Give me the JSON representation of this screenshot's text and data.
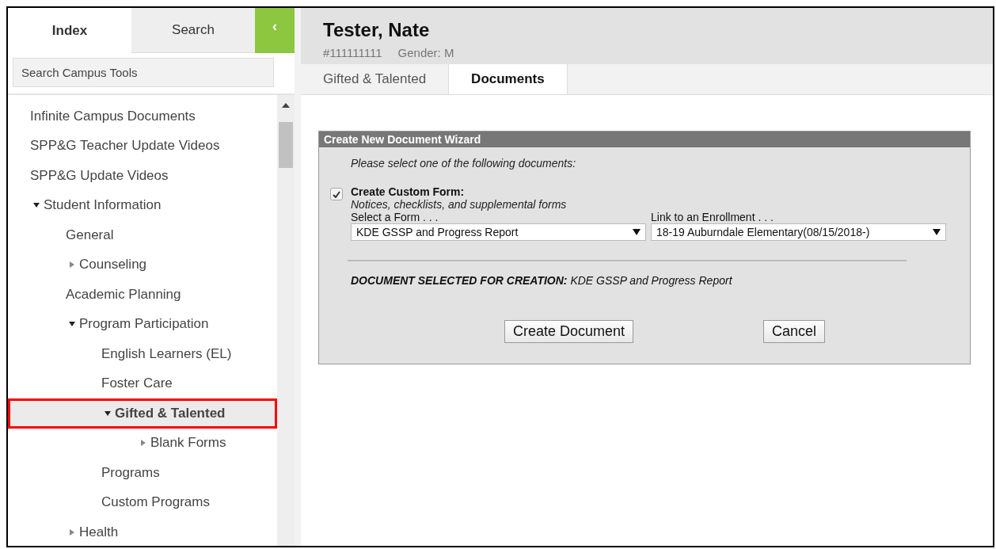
{
  "sidebar": {
    "tabs": [
      {
        "label": "Index",
        "selected": true
      },
      {
        "label": "Search",
        "selected": false
      }
    ],
    "collapse_button": {
      "label": "‹"
    },
    "search": {
      "placeholder": "Search Campus Tools"
    },
    "tree": [
      {
        "label": "Infinite Campus Documents",
        "kind": "leaf",
        "selected": false
      },
      {
        "label": "SPP&G Teacher Update Videos",
        "kind": "leaf",
        "selected": false
      },
      {
        "label": "SPP&G Update Videos",
        "kind": "leaf",
        "selected": false
      },
      {
        "label": "Student Information",
        "kind": "folder",
        "expanded": true,
        "selected": false,
        "children": [
          {
            "label": "General",
            "kind": "leaf",
            "selected": false
          },
          {
            "label": "Counseling",
            "kind": "folder",
            "expanded": false,
            "selected": false
          },
          {
            "label": "Academic Planning",
            "kind": "leaf",
            "selected": false
          },
          {
            "label": "Program Participation",
            "kind": "folder",
            "expanded": true,
            "selected": false,
            "children": [
              {
                "label": "English Learners (EL)",
                "kind": "leaf",
                "selected": false
              },
              {
                "label": "Foster Care",
                "kind": "leaf",
                "selected": false
              },
              {
                "label": "Gifted & Talented",
                "kind": "folder",
                "expanded": true,
                "selected": true,
                "children": [
                  {
                    "label": "Blank Forms",
                    "kind": "folder",
                    "expanded": false,
                    "selected": false
                  }
                ]
              },
              {
                "label": "Programs",
                "kind": "leaf",
                "selected": false
              },
              {
                "label": "Custom Programs",
                "kind": "leaf",
                "selected": false
              }
            ]
          },
          {
            "label": "Health",
            "kind": "folder",
            "expanded": false,
            "selected": false
          }
        ]
      }
    ]
  },
  "student": {
    "name": "Tester, Nate",
    "id": "#111111111",
    "gender": "Gender: M"
  },
  "tabs": [
    {
      "label": "Gifted & Talented",
      "selected": false
    },
    {
      "label": "Documents",
      "selected": true
    }
  ],
  "wizard": {
    "title": "Create New Document Wizard",
    "instruction": "Please select one of the following documents:",
    "custom_form": {
      "checked": true,
      "label": "Create Custom Form:",
      "description": "Notices, checklists, and supplemental forms"
    },
    "form_select": {
      "label": "Select a Form . . .",
      "value": "KDE GSSP and Progress Report"
    },
    "enrollment_select": {
      "label": "Link to an Enrollment . . .",
      "value": "18-19 Auburndale Elementary(08/15/2018-)"
    },
    "selection": "**DOCUMENT SELECTED FOR CREATION:** KDE GSSP and Progress Report",
    "buttons": [
      "Create Document",
      "Cancel"
    ]
  }
}
